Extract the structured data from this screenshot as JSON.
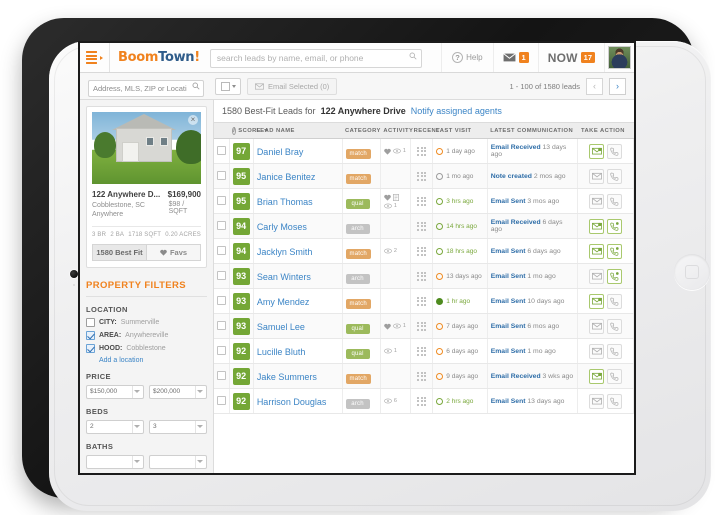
{
  "topnav": {
    "menu_icon": "hamburger-icon",
    "logo": {
      "part1": "Boom",
      "part2": "Town",
      "part3": "!"
    },
    "search_placeholder": "search leads by name, email, or phone",
    "search_value": "",
    "help_label": "Help",
    "mail_badge": "1",
    "now_label": "NOW",
    "now_badge": "17"
  },
  "subbar": {
    "address_placeholder": "Address, MLS, ZIP or Location",
    "address_value": "",
    "email_selected_label": "Email Selected (0)",
    "pager_text": "1 - 100 of 1580 leads",
    "prev_glyph": "‹",
    "next_glyph": "›"
  },
  "property": {
    "address": "122 Anywhere D...",
    "price": "$169,900",
    "city": "Cobblestone, SC Anywhere",
    "price_per_sqft": "$98 / SQFT",
    "specs": [
      "3 BR",
      "2 BA",
      "1718 SQFT",
      "0.20 ACRES"
    ],
    "tab_bestfit": "1580 Best Fit",
    "tab_favs": "Favs"
  },
  "filters": {
    "title": "PROPERTY FILTERS",
    "location_label": "LOCATION",
    "checkboxes": [
      {
        "key": "CITY:",
        "value": "Summerville",
        "checked": false
      },
      {
        "key": "AREA:",
        "value": "Anywhereville",
        "checked": true
      },
      {
        "key": "HOOD:",
        "value": "Cobblestone",
        "checked": true
      }
    ],
    "add_location": "Add a location",
    "price_label": "PRICE",
    "price_min": "$150,000",
    "price_max": "$200,000",
    "beds_label": "BEDS",
    "beds_min": "2",
    "beds_max": "3",
    "baths_label": "BATHS"
  },
  "results": {
    "count_text": "1580 Best-Fit Leads for",
    "property_name": "122 Anywhere Drive",
    "notify_link": "Notify assigned agents"
  },
  "table": {
    "headers": [
      "SCORE",
      "LEAD NAME",
      "CATEGORY",
      "ACTIVITY",
      "RECENT",
      "LAST VISIT",
      "LATEST COMMUNICATION",
      "TAKE ACTION"
    ],
    "rows": [
      {
        "score": "97",
        "name": "Daniel Bray",
        "category": "match",
        "cat_type": "match",
        "activity": [
          "heart",
          "eye"
        ],
        "activity_count": "1",
        "visit": "1 day ago",
        "visit_dot": "orange",
        "comm_type": "Email Received",
        "comm_when": "13 days ago",
        "email_on": true,
        "phone_on": false
      },
      {
        "score": "95",
        "name": "Janice Benitez",
        "category": "match",
        "cat_type": "match",
        "activity": [],
        "activity_count": "",
        "visit": "1 mo ago",
        "visit_dot": "gray",
        "comm_type": "Note created",
        "comm_when": "2 mos ago",
        "email_on": false,
        "phone_on": false
      },
      {
        "score": "95",
        "name": "Brian Thomas",
        "category": "qual",
        "cat_type": "qual",
        "activity": [
          "heart",
          "note",
          "eye"
        ],
        "activity_count": "1",
        "visit": "3 hrs ago",
        "visit_dot": "green",
        "comm_type": "Email Sent",
        "comm_when": "3 mos ago",
        "email_on": false,
        "phone_on": false
      },
      {
        "score": "94",
        "name": "Carly Moses",
        "category": "arch",
        "cat_type": "arch",
        "activity": [],
        "activity_count": "",
        "visit": "14 hrs ago",
        "visit_dot": "green",
        "comm_type": "Email Received",
        "comm_when": "6 days ago",
        "email_on": true,
        "phone_on": true
      },
      {
        "score": "94",
        "name": "Jacklyn Smith",
        "category": "match",
        "cat_type": "match",
        "activity": [
          "eye"
        ],
        "activity_count": "2",
        "visit": "18 hrs ago",
        "visit_dot": "green",
        "comm_type": "Email Sent",
        "comm_when": "6 days ago",
        "email_on": true,
        "phone_on": true
      },
      {
        "score": "93",
        "name": "Sean Winters",
        "category": "arch",
        "cat_type": "arch",
        "activity": [],
        "activity_count": "",
        "visit": "13 days ago",
        "visit_dot": "orange",
        "comm_type": "Email Sent",
        "comm_when": "1 mo ago",
        "email_on": false,
        "phone_on": true
      },
      {
        "score": "93",
        "name": "Amy Mendez",
        "category": "match",
        "cat_type": "match",
        "activity": [],
        "activity_count": "",
        "visit": "1 hr ago",
        "visit_dot": "filled",
        "comm_type": "Email Sent",
        "comm_when": "10 days ago",
        "email_on": true,
        "phone_on": false
      },
      {
        "score": "93",
        "name": "Samuel Lee",
        "category": "qual",
        "cat_type": "qual",
        "activity": [
          "heart",
          "eye"
        ],
        "activity_count": "1",
        "visit": "7 days ago",
        "visit_dot": "orange",
        "comm_type": "Email Sent",
        "comm_when": "6 mos ago",
        "email_on": false,
        "phone_on": false
      },
      {
        "score": "92",
        "name": "Lucille Bluth",
        "category": "qual",
        "cat_type": "qual",
        "activity": [
          "eye"
        ],
        "activity_count": "1",
        "visit": "6 days ago",
        "visit_dot": "orange",
        "comm_type": "Email Sent",
        "comm_when": "1 mo ago",
        "email_on": false,
        "phone_on": false
      },
      {
        "score": "92",
        "name": "Jake Summers",
        "category": "match",
        "cat_type": "match",
        "activity": [],
        "activity_count": "",
        "visit": "9 days ago",
        "visit_dot": "orange",
        "comm_type": "Email Received",
        "comm_when": "3 wks ago",
        "email_on": true,
        "phone_on": false
      },
      {
        "score": "92",
        "name": "Harrison Douglas",
        "category": "arch",
        "cat_type": "arch",
        "activity": [
          "eye"
        ],
        "activity_count": "6",
        "visit": "2 hrs ago",
        "visit_dot": "green",
        "comm_type": "Email Sent",
        "comm_when": "13 days ago",
        "email_on": false,
        "phone_on": false
      }
    ]
  },
  "colors": {
    "brand_orange": "#f0821e",
    "link_blue": "#3c85c6",
    "score_green": "#74a736",
    "cat_match": "#e2a765",
    "cat_qual": "#9cba5c",
    "cat_arch": "#c3c3c3"
  }
}
